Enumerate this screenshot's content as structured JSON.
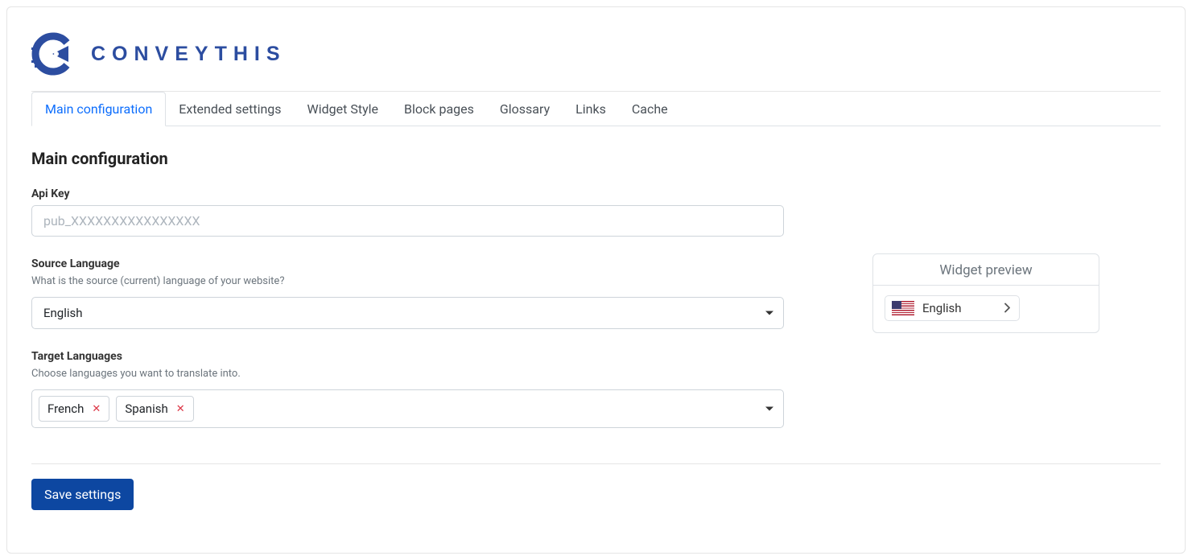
{
  "brand": {
    "name": "CONVEYTHIS"
  },
  "tabs": [
    {
      "label": "Main configuration",
      "active": true
    },
    {
      "label": "Extended settings",
      "active": false
    },
    {
      "label": "Widget Style",
      "active": false
    },
    {
      "label": "Block pages",
      "active": false
    },
    {
      "label": "Glossary",
      "active": false
    },
    {
      "label": "Links",
      "active": false
    },
    {
      "label": "Cache",
      "active": false
    }
  ],
  "section": {
    "title": "Main configuration"
  },
  "apiKey": {
    "label": "Api Key",
    "placeholder": "pub_XXXXXXXXXXXXXXXX",
    "value": ""
  },
  "sourceLanguage": {
    "label": "Source Language",
    "help": "What is the source (current) language of your website?",
    "selected": "English"
  },
  "targetLanguages": {
    "label": "Target Languages",
    "help": "Choose languages you want to translate into.",
    "tags": [
      "French",
      "Spanish"
    ]
  },
  "widgetPreview": {
    "title": "Widget preview",
    "currentLanguage": "English"
  },
  "actions": {
    "save": "Save settings"
  }
}
